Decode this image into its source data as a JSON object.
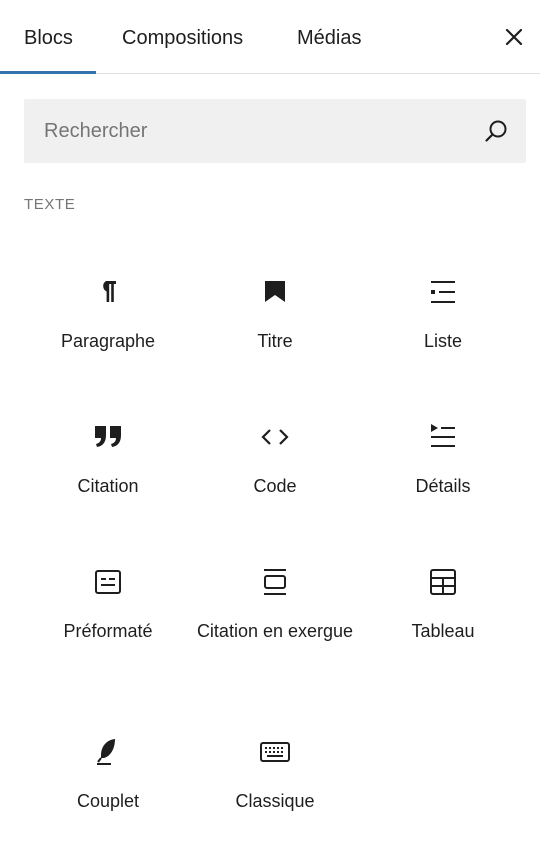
{
  "tabs": [
    {
      "label": "Blocs",
      "active": true
    },
    {
      "label": "Compositions",
      "active": false
    },
    {
      "label": "Médias",
      "active": false
    }
  ],
  "close_icon": "close-icon",
  "search": {
    "placeholder": "Rechercher",
    "value": "",
    "icon": "search-icon"
  },
  "section": {
    "title": "TEXTE"
  },
  "blocks": [
    {
      "label": "Paragraphe",
      "icon": "paragraph-icon"
    },
    {
      "label": "Titre",
      "icon": "bookmark-icon"
    },
    {
      "label": "Liste",
      "icon": "list-icon"
    },
    {
      "label": "Citation",
      "icon": "quote-icon"
    },
    {
      "label": "Code",
      "icon": "code-icon"
    },
    {
      "label": "Détails",
      "icon": "details-icon"
    },
    {
      "label": "Préformaté",
      "icon": "preformatted-icon"
    },
    {
      "label": "Citation en exergue",
      "icon": "pullquote-icon"
    },
    {
      "label": "Tableau",
      "icon": "table-icon"
    },
    {
      "label": "Couplet",
      "icon": "feather-icon"
    },
    {
      "label": "Classique",
      "icon": "keyboard-icon"
    }
  ],
  "colors": {
    "accent": "#3373ad",
    "text": "#1e1e1e",
    "muted": "#757575",
    "search_bg": "#f0f0f0",
    "divider": "#e0e0e0"
  }
}
